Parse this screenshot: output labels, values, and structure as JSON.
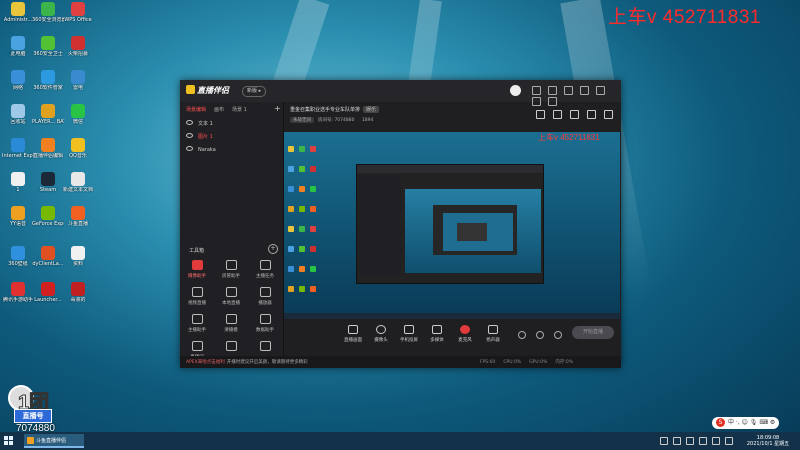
{
  "watermark": "上车v 452711831",
  "desktop_icons": [
    {
      "label": "Administr...",
      "color": "#e8c53a"
    },
    {
      "label": "360安全浏览器",
      "color": "#3bb54a"
    },
    {
      "label": "WPS Office",
      "color": "#e04040"
    },
    {
      "label": "此电脑",
      "color": "#4aa3e0"
    },
    {
      "label": "360安全卫士",
      "color": "#52c234"
    },
    {
      "label": "火柴招募",
      "color": "#d03030"
    },
    {
      "label": "网络",
      "color": "#3a90d8"
    },
    {
      "label": "360软件管家",
      "color": "#2c9ae0"
    },
    {
      "label": "雷电",
      "color": "#3a8ad0"
    },
    {
      "label": "回收站",
      "color": "#9fc7e8"
    },
    {
      "label": "PLAYER... BATTLEGR...",
      "color": "#e0a020"
    },
    {
      "label": "微信",
      "color": "#28c445"
    },
    {
      "label": "Internet Explorer",
      "color": "#2a8ad8"
    },
    {
      "label": "直播伴侣编辑",
      "color": "#f08020"
    },
    {
      "label": "QQ音乐",
      "color": "#f0c020"
    },
    {
      "label": "1",
      "color": "#f0f0f0"
    },
    {
      "label": "Steam",
      "color": "#1b2838"
    },
    {
      "label": "新建文本文档",
      "color": "#e8e8e8"
    },
    {
      "label": "YY语音",
      "color": "#f0a020"
    },
    {
      "label": "GeForce Experience",
      "color": "#76b900"
    },
    {
      "label": "斗鱼直播",
      "color": "#f06020"
    },
    {
      "label": "360壁纸",
      "color": "#3090e0"
    },
    {
      "label": "dyClientLa...",
      "color": "#e05020"
    },
    {
      "label": "资料",
      "color": "#f0f0f0"
    },
    {
      "label": "腾讯手游助手",
      "color": "#e03030"
    },
    {
      "label": "Launcher...",
      "color": "#d02020"
    },
    {
      "label": "毒液的",
      "color": "#c02020"
    }
  ],
  "window": {
    "logo": "直播伴侣",
    "plan_pill": "新版 ▸",
    "scene_tabs": [
      "场景编辑",
      "画布",
      "场景 1"
    ],
    "sources": [
      "文本 1",
      "图片 1",
      "Naraka"
    ],
    "tools_title": "工具箱",
    "tools": [
      "摄像助手",
      "房管助手",
      "主播任务",
      "视频直播",
      "本地直播",
      "播放器",
      "主播助手",
      "清播模",
      "数据助手",
      "直播间",
      "",
      ""
    ],
    "room_title": "重金召集职业选手专业车队单排",
    "room_badge": "娱乐",
    "room_category_chip": "永劫无间",
    "room_id_label": "房间号: 7074880",
    "room_fans": "1894",
    "preview_watermark": "上车v 452711831",
    "controls": [
      "直播画面",
      "摄像头",
      "手机投屏",
      "多媒体",
      "麦克风",
      "扬声器"
    ],
    "go_live": "开始直播",
    "notice_tag": "APEX来啦点击福利",
    "notice_text": "开播时建议开启美颜，敬请期待更多精彩",
    "stats": [
      "FPS:60",
      "CPU:0%",
      "GPU:0%",
      "内存:0%"
    ]
  },
  "streamer_badge": {
    "big": "1团",
    "box": "直播号",
    "number": "7074880"
  },
  "taskbar": {
    "app_label": "斗鱼直播伴侣",
    "time": "18:09:08",
    "date": "2021/10/1 星期五"
  },
  "ime_label": "中 ·, ☺ 🎙 ⌨ ⚙"
}
